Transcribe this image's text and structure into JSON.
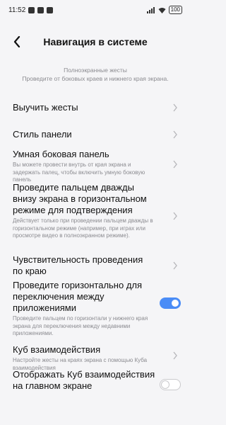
{
  "status_bar": {
    "time": "11:52",
    "battery": "100"
  },
  "header": {
    "title": "Навигация в системе"
  },
  "hint": {
    "line1": "Полноэкранные жесты",
    "line2": "Проведите от боковых краев и нижнего края экрана."
  },
  "items": [
    {
      "label": "Выучить жесты"
    },
    {
      "label": "Стиль панели"
    },
    {
      "label": "Умная боковая панель",
      "desc": "Вы можете провести внутрь от края экрана и задержать палец, чтобы включить умную боковую панель"
    },
    {
      "label": "Проведите пальцем дважды внизу экрана в горизонтальном режиме для подтверждения",
      "desc": "Действует только при проведении пальцем дважды в горизонтальном режиме (например, при играх или просмотре видео в полноэкранном режиме)."
    },
    {
      "label": "Чувствительность проведения по краю"
    },
    {
      "label": "Проведите горизонтально для переключения между приложениями",
      "desc": "Проведите пальцем по горизонтали у нижнего края экрана для переключения между недавними приложениями.",
      "toggle": true
    },
    {
      "label": "Куб взаимодействия",
      "desc": "Настройте жесты на краях экрана с помощью Куба взаимодействия"
    },
    {
      "label": "Отображать Куб взаимодействия на главном экране",
      "toggle": false
    }
  ],
  "colors": {
    "accent": "#4a8cf6",
    "background": "#f5f5f7",
    "secondary_text": "#8b8b90"
  },
  "icons": {
    "back": "chevron-left-icon",
    "row": "chevron-right-icon"
  }
}
